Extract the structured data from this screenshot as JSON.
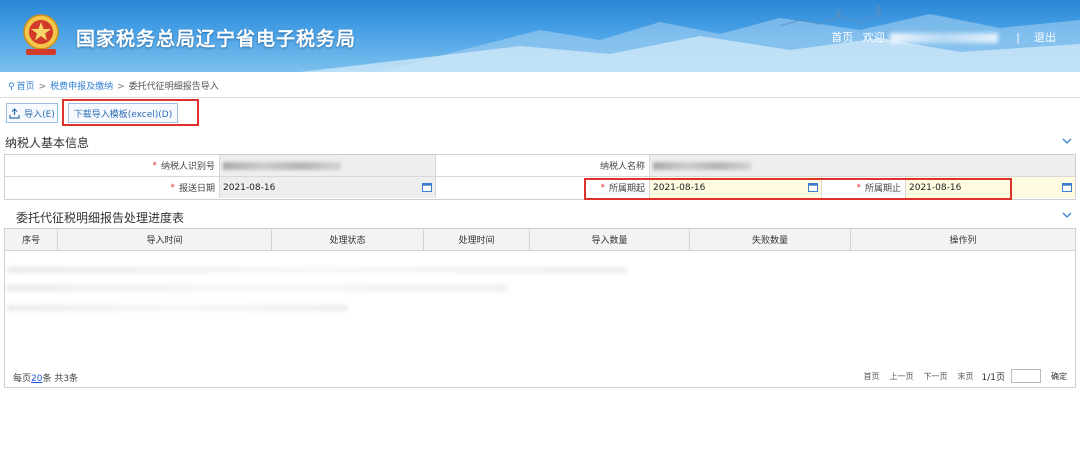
{
  "header": {
    "site_title": "国家税务总局辽宁省电子税务局",
    "links": {
      "home": "首页",
      "welcome": "欢迎,",
      "separator": "|",
      "logout": "退出"
    }
  },
  "breadcrumb": {
    "home": "首页",
    "level1": "税费申报及缴纳",
    "current": "委托代征明细报告导入",
    "separator": ">"
  },
  "toolbar": {
    "import_label": "导入(E)",
    "download_label": "下载导入模板(excel)(D)"
  },
  "taxpayer_section": {
    "title": "纳税人基本信息",
    "taxpayer_id_label": "纳税人识别号",
    "taxpayer_name_label": "纳税人名称",
    "submit_date_label": "报送日期",
    "submit_date_value": "2021-08-16",
    "period_start_label": "所属期起",
    "period_start_value": "2021-08-16",
    "period_end_label": "所属期止",
    "period_end_value": "2021-08-16",
    "required_mark": "*"
  },
  "progress_section": {
    "title": "委托代征税明细报告处理进度表",
    "columns": [
      "序号",
      "导入时间",
      "处理状态",
      "处理时间",
      "导入数量",
      "失败数量",
      "操作列"
    ]
  },
  "pager": {
    "per_page_prefix": "每页",
    "per_page_value": "20",
    "per_page_suffix": "条 共3条",
    "first": "首页",
    "prev": "上一页",
    "next": "下一页",
    "last": "末页",
    "page_info": "1/1页",
    "confirm": "确定"
  },
  "colors": {
    "header_blue": "#2a87d6",
    "link_blue": "#2f7fd3",
    "required_red": "#e0322c",
    "highlight_yellow": "#fffbe0"
  }
}
